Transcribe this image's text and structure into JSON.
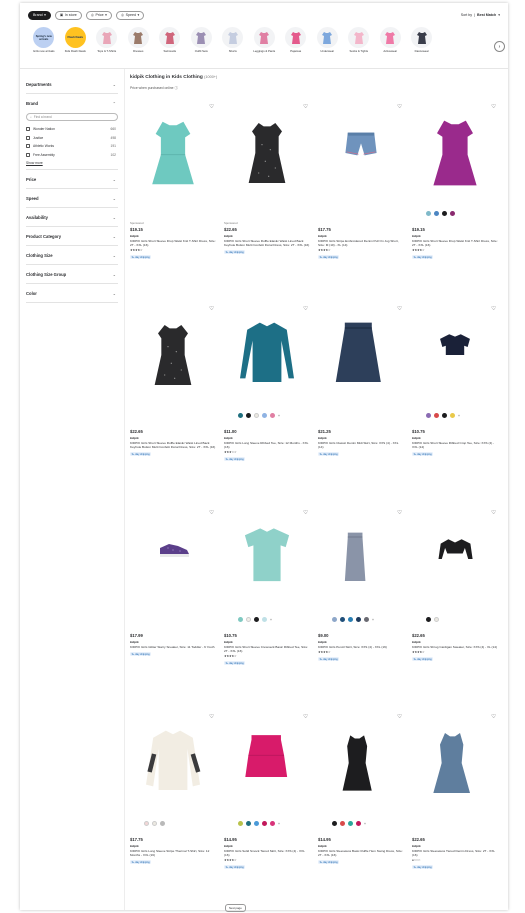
{
  "filters": {
    "brand_chip": "Brand",
    "in_store_chip": "In store",
    "price_chip": "Price",
    "speed_chip": "Speed",
    "sort_label": "Sort by",
    "sort_value": "Best Match"
  },
  "categories": [
    {
      "label": "Girls new arrivals",
      "circle_text": "Spring's new arrivals",
      "style": "blue"
    },
    {
      "label": "Kids Flash Deals",
      "circle_text": "Flash Deals",
      "style": "yellow"
    },
    {
      "label": "Tops & T-Shirts",
      "color": "#e9a6b8"
    },
    {
      "label": "Dresses",
      "color": "#9b7b6b"
    },
    {
      "label": "Swimsuits",
      "color": "#d0667c"
    },
    {
      "label": "Outfit Sets",
      "color": "#9b8fb3"
    },
    {
      "label": "Shorts",
      "color": "#c5cde0"
    },
    {
      "label": "Leggings & Pants",
      "color": "#e07fa3"
    },
    {
      "label": "Pajamas",
      "color": "#e45a8c"
    },
    {
      "label": "Underwear",
      "color": "#7ea8dd"
    },
    {
      "label": "Socks & Tights",
      "color": "#f3b6ca"
    },
    {
      "label": "Activewear",
      "color": "#ef7aa7"
    },
    {
      "label": "Dancewear",
      "color": "#3a3d4a"
    }
  ],
  "sidebar": {
    "departments": "Departments",
    "brand": "Brand",
    "brand_search_placeholder": "Find a brand",
    "brands": [
      {
        "name": "Wonder Nation",
        "count": "660"
      },
      {
        "name": "Justice",
        "count": "498"
      },
      {
        "name": "Athletic Works",
        "count": "191"
      },
      {
        "name": "Free Assembly",
        "count": "102"
      }
    ],
    "show_more": "Show more",
    "facets": [
      "Price",
      "Speed",
      "Availability",
      "Product Category",
      "Clothing Size",
      "Clothing Size Group",
      "Color"
    ]
  },
  "main": {
    "title": "kidpik Clothing in Kids Clothing",
    "count": "(1000+)",
    "subtitle": "Price when purchased online"
  },
  "products": [
    {
      "sponsored": "Sponsored",
      "price": "$19.15",
      "brand": "kidpik",
      "name": "KIDPIK Girls Short Sleeve Drop Waist Knit T-Shirt Dress, Size: 2T - XXL (16)",
      "stars": "★★★★☆",
      "reviews": "",
      "shipping": "3+ day shipping",
      "swatches": [],
      "image": "dress-teal"
    },
    {
      "sponsored": "Sponsored",
      "price": "$22.65",
      "brand": "kidpik",
      "name": "KIDPIK Girls Short Sleeve Ruffle Elastic Waist Lined Back Keyhole Button Multi Confetti Floral Dress, Size: 2T - XXL (16)",
      "stars": "",
      "reviews": "",
      "shipping": "3+ day shipping",
      "swatches": [],
      "image": "dress-black"
    },
    {
      "sponsored": "",
      "price": "$17.75",
      "brand": "kidpik",
      "name": "KIDPIK Girls Stripe Embroidered Denim Pull On Jog Short, Size: M (10) - XL (14)",
      "stars": "★★★★☆",
      "reviews": "",
      "shipping": "3+ day shipping",
      "swatches": [],
      "image": "shorts-denim"
    },
    {
      "sponsored": "",
      "price": "$19.15",
      "brand": "kidpik",
      "name": "KIDPIK Girls Short Sleeve Drop Waist Knit T-Shirt Dress, Size: 2T - XXL (16)",
      "stars": "★★★★☆",
      "reviews": "",
      "shipping": "3+ day shipping",
      "swatches": [
        "#7fb9c9",
        "#4c86c2",
        "#1d1d1f",
        "#8a2a6f"
      ],
      "image": "dress-purple"
    },
    {
      "sponsored": "",
      "price": "$22.65",
      "brand": "kidpik",
      "name": "KIDPIK Girls Short Sleeve Ruffle Elastic Waist Lined Back Keyhole Button Multi Confetti Floral Dress, Size: 2T - XXL (16)",
      "stars": "",
      "reviews": "",
      "shipping": "3+ day shipping",
      "swatches": [],
      "image": "dress-black"
    },
    {
      "sponsored": "",
      "price": "$11.00",
      "brand": "kidpik",
      "name": "KIDPIK Girls Long Sleeve Ribbed Tee, Size: 12 Months - XXL (16)",
      "stars": "★★★☆☆",
      "reviews": "",
      "shipping": "3+ day shipping",
      "swatches": [
        "#1f6f7f",
        "#1d1d1f",
        "#ece9e2",
        "#8fb3e3",
        "#e07fa3"
      ],
      "more": "+",
      "image": "tee-teal"
    },
    {
      "sponsored": "",
      "price": "$21.25",
      "brand": "kidpik",
      "name": "KIDPIK Girls Classic Denim Midi Skirt, Size: XXS (4) - XXL (14)",
      "stars": "",
      "reviews": "",
      "shipping": "3+ day shipping",
      "swatches": [],
      "image": "skirt-denim"
    },
    {
      "sponsored": "",
      "price": "$10.75",
      "brand": "kidpik",
      "name": "KIDPIK Girls Short Sleeve Ribbed Crop Tee, Size: XXS (4) - XXL (14)",
      "stars": "",
      "reviews": "",
      "shipping": "3+ day shipping",
      "swatches": [
        "#8a6bb3",
        "#d84a4a",
        "#1d1d1f",
        "#e9c94a"
      ],
      "more": "+",
      "image": "crop-navy"
    },
    {
      "sponsored": "",
      "price": "$17.99",
      "brand": "kidpik",
      "name": "KIDPIK Girls Glitter Starry Sneaker, Size: 11 Toddler - 6 Youth",
      "stars": "",
      "reviews": "",
      "shipping": "3+ day shipping",
      "swatches": [],
      "image": "sneaker"
    },
    {
      "sponsored": "",
      "price": "$10.75",
      "brand": "kidpik",
      "name": "KIDPIK Girls Short Sleeve Crewneck Basic Ribbed Tee, Size: 2T - XXL (16)",
      "stars": "★★★★☆",
      "reviews": "",
      "shipping": "3+ day shipping",
      "swatches": [
        "#7fc9c1",
        "#f1efe9",
        "#1d1d1f",
        "#bfe0e6"
      ],
      "more": "+",
      "image": "tee-mint"
    },
    {
      "sponsored": "",
      "price": "$9.00",
      "brand": "kidpik",
      "name": "KIDPIK Girls Pencil Skirt, Size: XXS (4) - XXL (16)",
      "stars": "★★★★☆",
      "reviews": "",
      "shipping": "3+ day shipping",
      "swatches": [
        "#8ea7c9",
        "#1f4f7a",
        "#2a7fb3",
        "#1d3a5c",
        "#6a6a72"
      ],
      "more": "+",
      "image": "skirt-grey"
    },
    {
      "sponsored": "",
      "price": "$22.65",
      "brand": "kidpik",
      "name": "KIDPIK Girls Shrug Cardigan Sweater, Size: XXS (4) - XL (14)",
      "stars": "★★★★☆",
      "reviews": "",
      "shipping": "3+ day shipping",
      "swatches": [
        "#1d1d1f",
        "#ece9e2"
      ],
      "image": "cardigan"
    },
    {
      "sponsored": "",
      "price": "$17.75",
      "brand": "kidpik",
      "name": "KIDPIK Girls Long Sleeve Stripe Thermal T-Shirt, Size: 12 Months - XXL (16)",
      "stars": "",
      "reviews": "",
      "shipping": "3+ day shipping",
      "swatches": [
        "#f2d6d6",
        "#ece9e2",
        "#b9b9b9"
      ],
      "image": "thermal"
    },
    {
      "sponsored": "",
      "price": "$14.95",
      "brand": "kidpik",
      "name": "KIDPIK Girls Solid Smock Tiered Skirt, Size: XXS (4) - XXL (16)",
      "stars": "★★★★☆",
      "reviews": "",
      "shipping": "3+ day shipping",
      "swatches": [
        "#b9c24a",
        "#1f6f7f",
        "#4a9ad8",
        "#c2185b",
        "#d8347a"
      ],
      "more": "+",
      "image": "skirt-pink"
    },
    {
      "sponsored": "",
      "price": "$14.95",
      "brand": "kidpik",
      "name": "KIDPIK Girls Sleeveless Basic Ruffle Hem Swing Dress, Size: 2T - XXL (16)",
      "stars": "",
      "reviews": "",
      "shipping": "3+ day shipping",
      "swatches": [
        "#1d1d1f",
        "#d84a4a",
        "#2aa89a",
        "#c2185b"
      ],
      "more": "+",
      "image": "dress-sleeveless"
    },
    {
      "sponsored": "",
      "price": "$22.65",
      "brand": "kidpik",
      "name": "KIDPIK Girls Sleeveless Tiered Denim Dress, Size: 2T - XXL (16)",
      "stars": "●○○○○",
      "reviews": "",
      "shipping": "3+ day shipping",
      "swatches": [],
      "image": "dress-denim"
    }
  ],
  "pager": {
    "label": "Next page"
  }
}
